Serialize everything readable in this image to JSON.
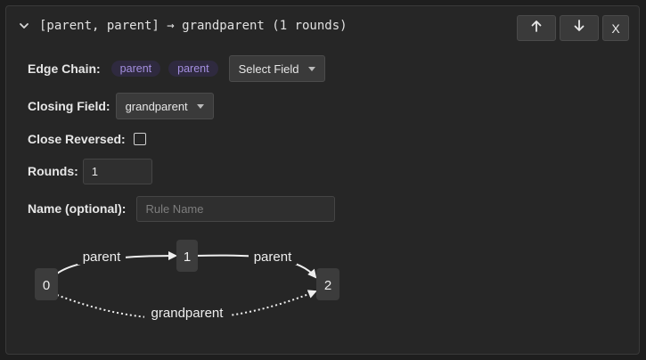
{
  "header": {
    "title": "[parent, parent] → grandparent (1 rounds)",
    "close_label": "X"
  },
  "form": {
    "edge_chain_label": "Edge Chain:",
    "edge_chain": [
      "parent",
      "parent"
    ],
    "select_field_label": "Select Field",
    "closing_field_label": "Closing Field:",
    "closing_field_value": "grandparent",
    "close_reversed_label": "Close Reversed:",
    "close_reversed_checked": false,
    "rounds_label": "Rounds:",
    "rounds_value": "1",
    "name_label": "Name (optional):",
    "name_placeholder": "Rule Name",
    "name_value": ""
  },
  "graph": {
    "nodes": [
      "0",
      "1",
      "2"
    ],
    "edges": [
      {
        "from": "0",
        "to": "1",
        "label": "parent",
        "style": "solid"
      },
      {
        "from": "1",
        "to": "2",
        "label": "parent",
        "style": "solid"
      },
      {
        "from": "0",
        "to": "2",
        "label": "grandparent",
        "style": "dotted"
      }
    ]
  },
  "colors": {
    "chip_bg": "#2f2a3f",
    "chip_text": "#a48fe0",
    "panel_bg": "#262626",
    "node_bg": "#3c3c3c"
  },
  "icons": {
    "collapse": "chevron-down-icon",
    "move_up": "arrow-up-icon",
    "move_down": "arrow-down-icon"
  }
}
